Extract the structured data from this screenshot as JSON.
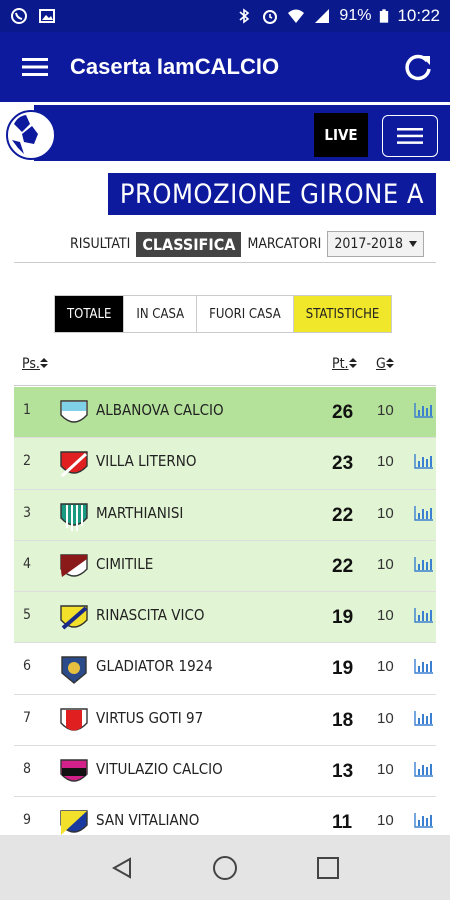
{
  "status": {
    "battery": "91%",
    "time": "10:22"
  },
  "app": {
    "title": "Caserta IamCALCIO"
  },
  "brand": {
    "live_label": "LIVE"
  },
  "league": {
    "title": "PROMOZIONE GIRONE A"
  },
  "subtabs": {
    "results": "RISULTATI",
    "standings": "CLASSIFICA",
    "scorers": "MARCATORI",
    "season": "2017-2018"
  },
  "filters": {
    "total": "TOTALE",
    "home": "IN CASA",
    "away": "FUORI CASA",
    "stats": "STATISTICHE"
  },
  "table": {
    "headers": {
      "pos": "Ps.",
      "pts": "Pt.",
      "games": "G"
    },
    "rows": [
      {
        "pos": "1",
        "team": "ALBANOVA CALCIO",
        "pts": "26",
        "games": "10",
        "crest": "albanova-crest",
        "bg": "#b4e29a"
      },
      {
        "pos": "2",
        "team": "VILLA LITERNO",
        "pts": "23",
        "games": "10",
        "crest": "villa-literno-crest",
        "bg": "#e1f4d3"
      },
      {
        "pos": "3",
        "team": "MARTHIANISI",
        "pts": "22",
        "games": "10",
        "crest": "marthianisi-crest",
        "bg": "#e1f4d3"
      },
      {
        "pos": "4",
        "team": "CIMITILE",
        "pts": "22",
        "games": "10",
        "crest": "cimitile-crest",
        "bg": "#e1f4d3"
      },
      {
        "pos": "5",
        "team": "RINASCITA VICO",
        "pts": "19",
        "games": "10",
        "crest": "rinascita-vico-crest",
        "bg": "#e1f4d3"
      },
      {
        "pos": "6",
        "team": "GLADIATOR 1924",
        "pts": "19",
        "games": "10",
        "crest": "gladiator-crest",
        "bg": "#ffffff"
      },
      {
        "pos": "7",
        "team": "VIRTUS GOTI 97",
        "pts": "18",
        "games": "10",
        "crest": "virtus-goti-crest",
        "bg": "#ffffff"
      },
      {
        "pos": "8",
        "team": "VITULAZIO CALCIO",
        "pts": "13",
        "games": "10",
        "crest": "vitulazio-crest",
        "bg": "#ffffff"
      },
      {
        "pos": "9",
        "team": "SAN VITALIANO",
        "pts": "11",
        "games": "10",
        "crest": "san-vitaliano-crest",
        "bg": "#ffffff"
      }
    ]
  },
  "colors": {
    "brand_blue": "#0d1a9e",
    "statusbar": "#0a1a8c",
    "stats_yellow": "#f0e62a",
    "chart_icon": "#3a7fd0"
  }
}
